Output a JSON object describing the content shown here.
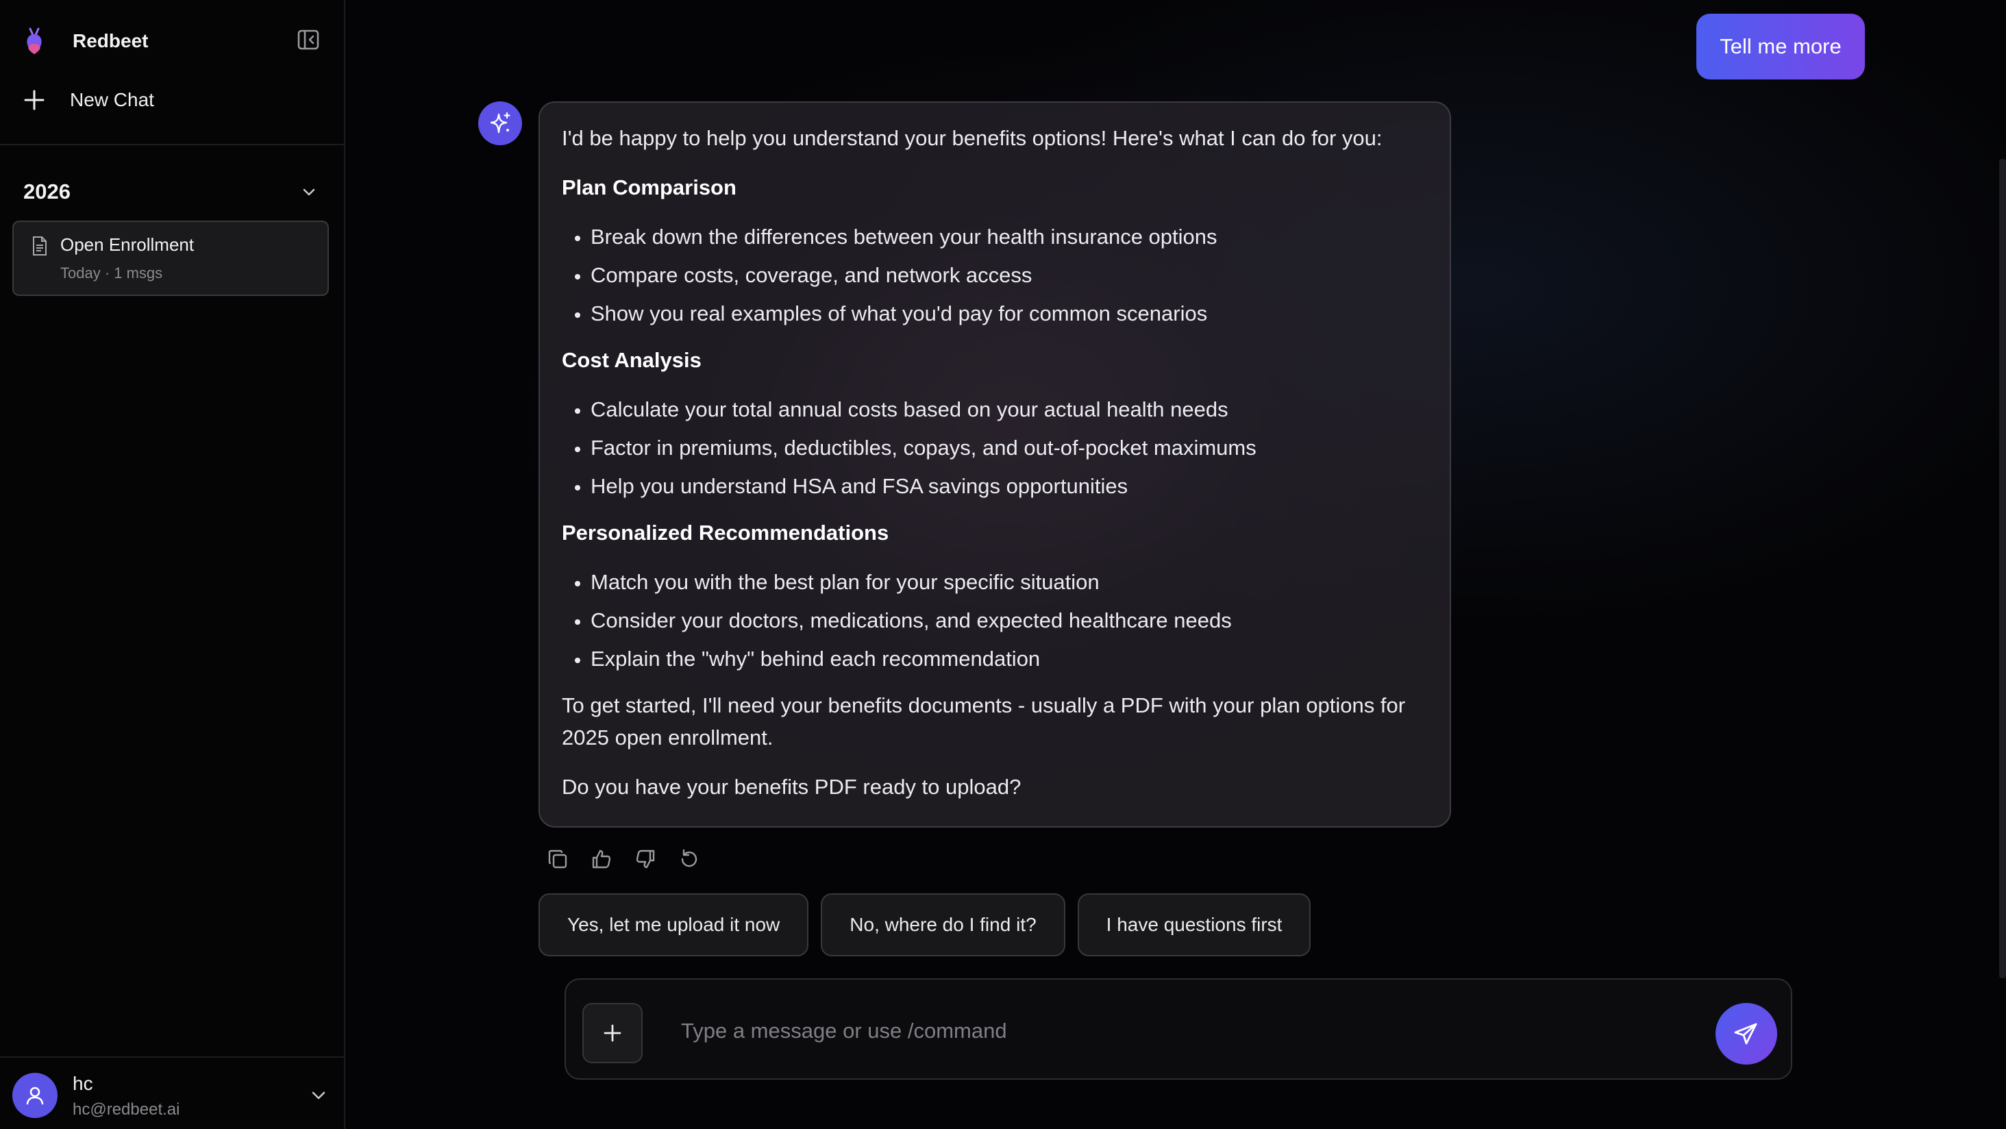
{
  "colors": {
    "accent": "#5b4fe6",
    "accent_gradient_start": "#4d5ef0",
    "accent_gradient_end": "#7a46e8",
    "background": "#000000",
    "card": "#1a1a1c"
  },
  "sidebar": {
    "brand": {
      "name": "Redbeet",
      "logo_icon": "beet-logo-icon"
    },
    "collapse_icon": "sidebar-collapse-icon",
    "new_chat": {
      "label": "New Chat",
      "icon": "plus-icon"
    },
    "group": {
      "label": "2026",
      "icon": "chevron-down-icon",
      "conversations": [
        {
          "title": "Open Enrollment",
          "meta": "Today · 1 msgs",
          "icon": "document-icon"
        }
      ]
    },
    "user": {
      "name": "hc",
      "email": "hc@redbeet.ai",
      "icon": "user-icon"
    }
  },
  "chat": {
    "user_message": "Tell me more",
    "assistant": {
      "avatar_icon": "sparkle-icon",
      "intro": "I'd be happy to help you understand your benefits options! Here's what I can do for you:",
      "sections": [
        {
          "heading": "Plan Comparison",
          "items": [
            "Break down the differences between your health insurance options",
            "Compare costs, coverage, and network access",
            "Show you real examples of what you'd pay for common scenarios"
          ]
        },
        {
          "heading": "Cost Analysis",
          "items": [
            "Calculate your total annual costs based on your actual health needs",
            "Factor in premiums, deductibles, copays, and out-of-pocket maximums",
            "Help you understand HSA and FSA savings opportunities"
          ]
        },
        {
          "heading": "Personalized Recommendations",
          "items": [
            "Match you with the best plan for your specific situation",
            "Consider your doctors, medications, and expected healthcare needs",
            "Explain the \"why\" behind each recommendation"
          ]
        }
      ],
      "closing": "To get started, I'll need your benefits documents - usually a PDF with your plan options for 2025 open enrollment.",
      "question": "Do you have your benefits PDF ready to upload?"
    },
    "actions": [
      "copy-icon",
      "thumbs-up-icon",
      "thumbs-down-icon",
      "regenerate-icon"
    ],
    "suggestions": [
      "Yes, let me upload it now",
      "No, where do I find it?",
      "I have questions first"
    ]
  },
  "composer": {
    "placeholder": "Type a message or use /command",
    "value": "",
    "attach_icon": "plus-icon",
    "send_icon": "send-icon"
  }
}
